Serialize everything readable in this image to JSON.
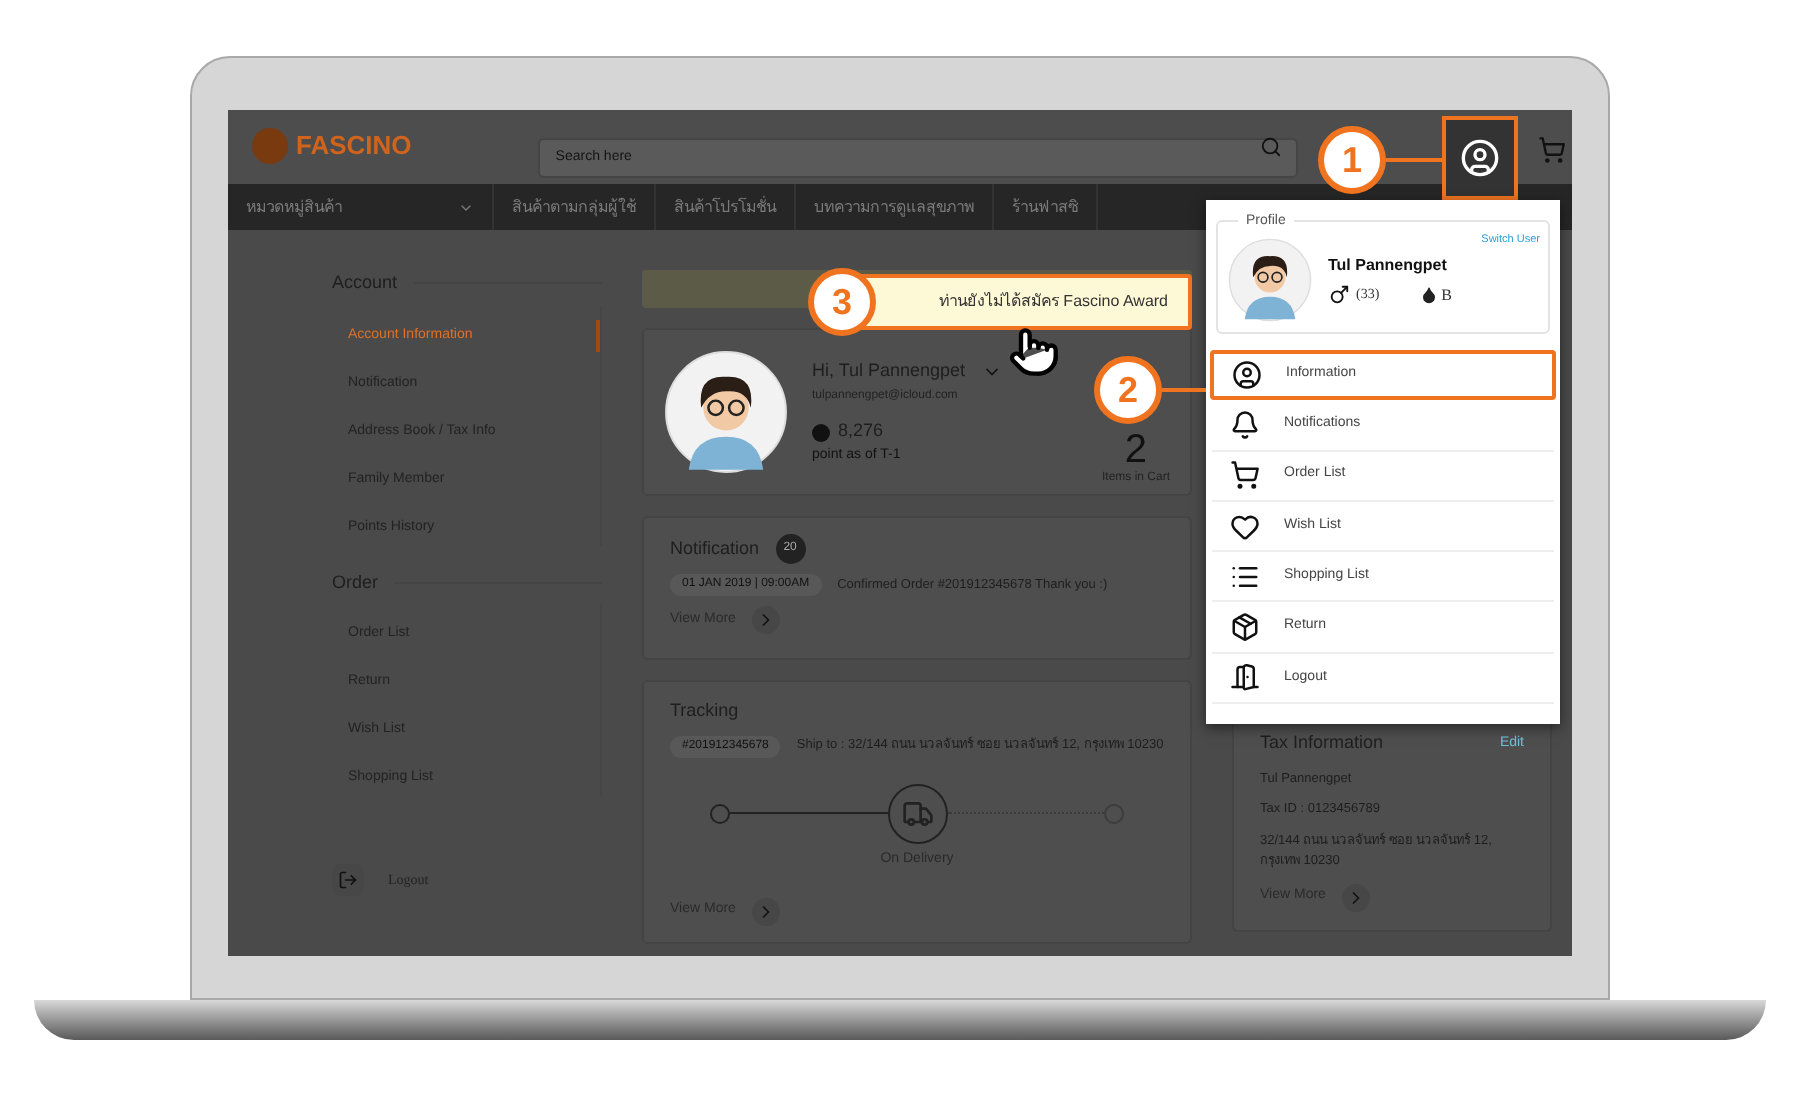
{
  "header": {
    "logo": "FASCINO",
    "search": {
      "placeholder": "Search here"
    }
  },
  "nav": [
    {
      "label": "หมวดหมู่สินค้า",
      "kind": "dropdown"
    },
    {
      "label": "สินค้าตามกลุ่มผู้ใช้",
      "kind": "link"
    },
    {
      "label": "สินค้าโปรโมชั่น",
      "kind": "link"
    },
    {
      "label": "บทความการดูแลสุขภาพ",
      "kind": "link"
    },
    {
      "label": "ร้านฟาสซิ",
      "kind": "link"
    }
  ],
  "sidebar": {
    "sections": [
      {
        "title": "Account",
        "items": [
          {
            "label": "Account Information",
            "selected": true
          },
          {
            "label": "Notification",
            "selected": false
          },
          {
            "label": "Address Book / Tax Info",
            "selected": false
          },
          {
            "label": "Family Member",
            "selected": false
          },
          {
            "label": "Points History",
            "selected": false
          }
        ]
      },
      {
        "title": "Order",
        "items": [
          {
            "label": "Order List",
            "selected": false
          },
          {
            "label": "Return",
            "selected": false
          },
          {
            "label": "Wish List",
            "selected": false
          },
          {
            "label": "Shopping List",
            "selected": false
          }
        ]
      }
    ],
    "logout": "Logout"
  },
  "profile_card": {
    "greeting": "Hi, Tul Pannengpet",
    "email": "tulpannengpet@icloud.com",
    "points": "8,276",
    "points_note": "point as of T-1",
    "cart_count": "2",
    "cart_label": "Items in Cart"
  },
  "notification": {
    "title": "Notification",
    "count": "20",
    "datetime": "01 JAN 2019 | 09:00AM",
    "message": "Confirmed Order #201912345678 Thank you :)",
    "view_more": "View More"
  },
  "tracking": {
    "title": "Tracking",
    "order": "#201912345678",
    "ship_to": "Ship to : 32/144 ถนน นวลจันทร์ ซอย นวลจันทร์ 12, กรุงเทพ 10230",
    "steps": [
      {
        "kind": "done"
      },
      {
        "kind": "current",
        "label": "On Delivery"
      },
      {
        "kind": "pending"
      }
    ],
    "view_more": "View More"
  },
  "tax": {
    "title": "Tax Information",
    "edit": "Edit",
    "name": "Tul Pannengpet",
    "tax_id": "Tax ID : 0123456789",
    "address": "32/144 ถนน นวลจันทร์ ซอย นวลจันทร์ 12, กรุงเทพ 10230",
    "view_more": "View More"
  },
  "profile_menu": {
    "legend": "Profile",
    "name": "Tul Pannengpet",
    "switch_user": "Switch User",
    "age": "(33)",
    "blood_type": "B",
    "items": [
      {
        "label": "Information",
        "selected": true
      },
      {
        "label": "Notifications",
        "selected": false
      },
      {
        "label": "Order List",
        "selected": false
      },
      {
        "label": "Wish List",
        "selected": false
      },
      {
        "label": "Shopping List",
        "selected": false
      },
      {
        "label": "Return",
        "selected": false
      },
      {
        "label": "Logout",
        "selected": false
      }
    ]
  },
  "tooltip": {
    "text": "ท่านยังไม่ได้สมัคร Fascino Award"
  },
  "callouts": [
    "1",
    "2",
    "3"
  ]
}
